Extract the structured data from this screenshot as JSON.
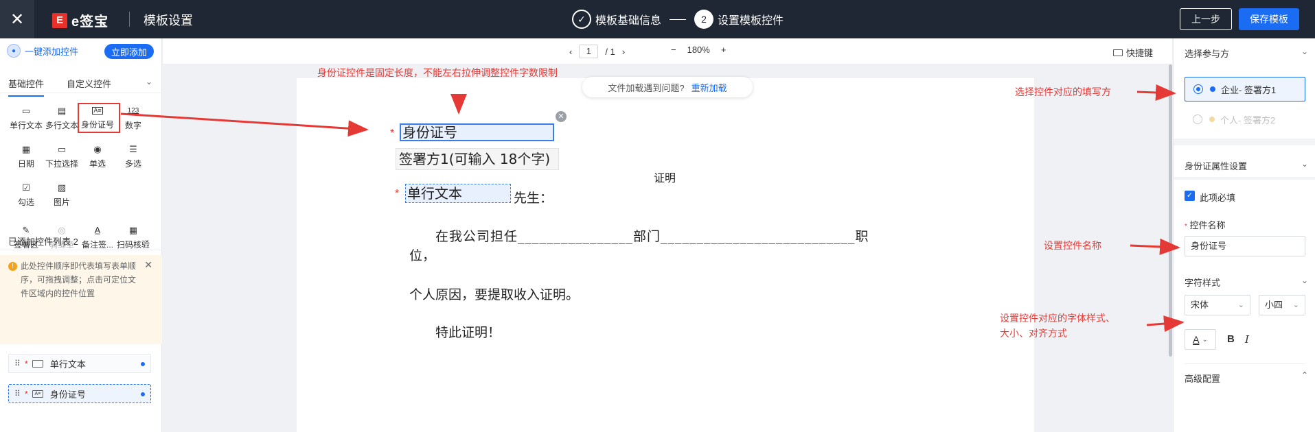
{
  "topbar": {
    "close_icon": "close-icon",
    "logo_mark": "E",
    "logo_text": "e签宝",
    "title": "模板设置",
    "step1_label": "模板基础信息",
    "step2_number": "2",
    "step2_label": "设置模板控件",
    "prev_button": "上一步",
    "save_button": "保存模板"
  },
  "left_panel": {
    "quick_add_label": "一键添加控件",
    "quick_add_button": "立即添加",
    "tabs": [
      "基础控件",
      "自定义控件"
    ],
    "controls": [
      {
        "label": "单行文本",
        "icon": "▭"
      },
      {
        "label": "多行文本",
        "icon": "▤"
      },
      {
        "label": "身份证号",
        "icon": "A≡"
      },
      {
        "label": "数字",
        "icon": "123"
      },
      {
        "label": "日期",
        "icon": "📅"
      },
      {
        "label": "下拉选择",
        "icon": "▭"
      },
      {
        "label": "单选",
        "icon": "◉"
      },
      {
        "label": "多选",
        "icon": "☰"
      },
      {
        "label": "勾选",
        "icon": "☑"
      },
      {
        "label": "图片",
        "icon": "▨"
      }
    ],
    "sign_controls": [
      {
        "label": "签署区",
        "icon": "✎"
      },
      {
        "label": "骑缝章",
        "icon": "◎"
      },
      {
        "label": "备注签...",
        "icon": "A̲"
      },
      {
        "label": "扫码核验",
        "icon": "▦"
      }
    ],
    "added_list_title": "已添加控件列表 2",
    "notice_text": "此处控件顺序即代表填写表单顺序，可拖拽调整；点击可定位文件区域内的控件位置",
    "added_items": [
      {
        "label": "单行文本"
      },
      {
        "label": "身份证号"
      }
    ]
  },
  "toolbar": {
    "prev_page": "‹",
    "page_current": "1",
    "page_total": "/ 1",
    "next_page": "›",
    "zoom_out": "−",
    "zoom_level": "180%",
    "zoom_in": "+",
    "shortcut_label": "快捷键"
  },
  "document": {
    "reload_tip": "文件加载遇到问题?",
    "reload_link": "重新加载",
    "id_field_label": "身份证号",
    "signer_hint": "签署方1(可输入 18个字)",
    "cert_title": "证明",
    "text_field_label": "单行文本",
    "after_text_field": "先生：",
    "para1_line1": "在我公司担任________________部门___________________________职",
    "para1_line2": "位，",
    "para2": "个人原因，要提取收入证明。",
    "para3": "特此证明！"
  },
  "right_panel": {
    "select_party_title": "选择参与方",
    "parties": [
      {
        "label": "企业- 签署方1",
        "color": "#1a6cf3"
      },
      {
        "label": "个人- 签署方2",
        "color": "#f5d9a3"
      }
    ],
    "attr_title": "身份证属性设置",
    "required_label": "此项必填",
    "name_label": "控件名称",
    "name_value": "身份证号",
    "font_style_title": "字符样式",
    "font_family": "宋体",
    "font_size": "小四",
    "color_label": "A",
    "bold_label": "B",
    "italic_label": "I",
    "advanced_title": "高级配置"
  },
  "annotations": {
    "top_note": "身份证控件是固定长度，不能左右拉伸调整控件字数限制",
    "party_note": "选择控件对应的填写方",
    "name_note": "设置控件名称",
    "font_note_line1": "设置控件对应的字体样式、",
    "font_note_line2": "大小、对齐方式"
  }
}
